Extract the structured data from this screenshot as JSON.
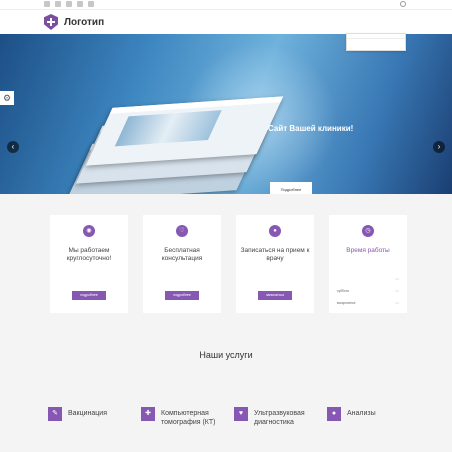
{
  "topbar": {
    "social_icons": [
      "facebook-icon",
      "twitter-icon",
      "googleplus-icon",
      "linkedin-icon",
      "rss-icon"
    ],
    "contacts": ""
  },
  "header": {
    "logo_text": "Логотип",
    "nav": [
      {
        "label": "",
        "active": false
      },
      {
        "label": "",
        "active": false
      },
      {
        "label": "",
        "active": false
      },
      {
        "label": "",
        "active": false
      },
      {
        "label": "",
        "active": false
      },
      {
        "label": "",
        "active": false
      },
      {
        "label": "",
        "active": true
      }
    ],
    "dropdown": [
      ""
    ]
  },
  "hero": {
    "title": "Сайт Вашей клиники!",
    "subtitle": "",
    "subtitle2": "",
    "button": "Подробнее",
    "slides_total": 4,
    "active_slide": 3
  },
  "cards": [
    {
      "icon": "camera-icon",
      "title": "Мы работаем круглосуточно!",
      "text": "",
      "button": "подробнее"
    },
    {
      "icon": "heart-shield-icon",
      "title": "Бесплатная консультация",
      "text": "",
      "button": "подробнее"
    },
    {
      "icon": "people-icon",
      "title": "Записаться на прием к врачу",
      "text": "",
      "button": "записаться"
    }
  ],
  "hours": {
    "title": "Время работы",
    "rows": [
      {
        "day": "",
        "time": ""
      },
      {
        "day": "суббота",
        "time": ""
      },
      {
        "day": "воскресенье",
        "time": ""
      }
    ]
  },
  "services": {
    "title": "Наши услуги",
    "intro": "",
    "items": [
      {
        "icon": "syringe-icon",
        "title": "Вакцинация",
        "text": ""
      },
      {
        "icon": "plus-icon",
        "title": "Компьютерная томография (КТ)",
        "text": ""
      },
      {
        "icon": "heart-icon",
        "title": "Ультразвуковая диагностика",
        "text": ""
      },
      {
        "icon": "drop-icon",
        "title": "Анализы",
        "text": ""
      }
    ]
  },
  "colors": {
    "accent": "#8658b3",
    "logo": "#7a4fa0"
  }
}
